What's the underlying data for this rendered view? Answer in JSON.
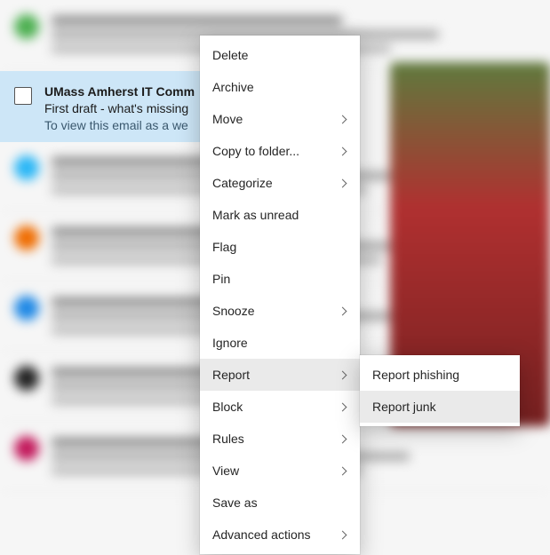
{
  "selected_email": {
    "sender": "UMass Amherst IT Comm",
    "subject": "First draft - what's missing",
    "preview": "To view this email as a we"
  },
  "menu": {
    "items": [
      {
        "label": "Delete",
        "submenu": false,
        "hovered": false
      },
      {
        "label": "Archive",
        "submenu": false,
        "hovered": false
      },
      {
        "label": "Move",
        "submenu": true,
        "hovered": false
      },
      {
        "label": "Copy to folder...",
        "submenu": true,
        "hovered": false
      },
      {
        "label": "Categorize",
        "submenu": true,
        "hovered": false
      },
      {
        "label": "Mark as unread",
        "submenu": false,
        "hovered": false
      },
      {
        "label": "Flag",
        "submenu": false,
        "hovered": false
      },
      {
        "label": "Pin",
        "submenu": false,
        "hovered": false
      },
      {
        "label": "Snooze",
        "submenu": true,
        "hovered": false
      },
      {
        "label": "Ignore",
        "submenu": false,
        "hovered": false
      },
      {
        "label": "Report",
        "submenu": true,
        "hovered": true
      },
      {
        "label": "Block",
        "submenu": true,
        "hovered": false
      },
      {
        "label": "Rules",
        "submenu": true,
        "hovered": false
      },
      {
        "label": "View",
        "submenu": true,
        "hovered": false
      },
      {
        "label": "Save as",
        "submenu": false,
        "hovered": false
      },
      {
        "label": "Advanced actions",
        "submenu": true,
        "hovered": false
      }
    ]
  },
  "submenu": {
    "items": [
      {
        "label": "Report phishing",
        "hovered": false
      },
      {
        "label": "Report junk",
        "hovered": true
      }
    ]
  }
}
